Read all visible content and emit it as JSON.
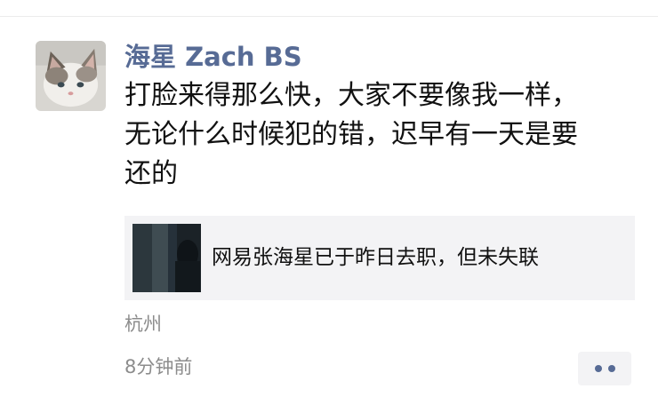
{
  "post": {
    "username": "海星 Zach BS",
    "text": "打脸来得那么快，大家不要像我一样，\n无论什么时候犯的错，迟早有一天是要\n还的",
    "location": "杭州",
    "timestamp": "8分钟前"
  },
  "link_card": {
    "title": "网易张海星已于昨日去职，但未失联"
  },
  "icons": {
    "avatar": "cat-photo-avatar",
    "thumbnail": "dark-photo-thumbnail",
    "more": "more-dots-icon"
  },
  "colors": {
    "username": "#576b95",
    "card_background": "#f3f3f5",
    "meta_text": "#8c8c8c"
  }
}
